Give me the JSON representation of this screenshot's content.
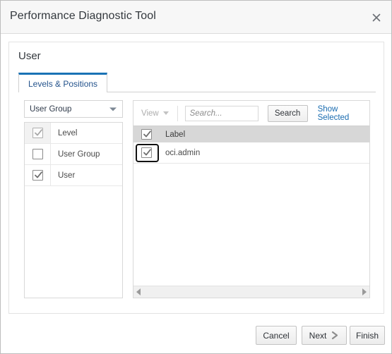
{
  "window": {
    "title": "Performance Diagnostic Tool",
    "close_icon": "close-icon"
  },
  "page": {
    "title": "User"
  },
  "tabs": [
    {
      "label": "Levels & Positions",
      "active": true
    }
  ],
  "left_panel": {
    "dropdown": {
      "selected": "User Group",
      "arrow_icon": "chevron-down-icon"
    },
    "rows": [
      {
        "label": "Level",
        "checked": true,
        "disabled": true
      },
      {
        "label": "User Group",
        "checked": false,
        "disabled": false
      },
      {
        "label": "User",
        "checked": true,
        "disabled": false
      }
    ]
  },
  "right_panel": {
    "toolbar": {
      "view_label": "View",
      "view_arrow_icon": "chevron-down-icon",
      "search_placeholder": "Search...",
      "search_value": "",
      "search_button": "Search",
      "show_selected_link": "Show Selected"
    },
    "grid": {
      "header": {
        "column_label": "Label",
        "select_all_checked": true
      },
      "rows": [
        {
          "label": "oci.admin",
          "checked": true,
          "focused": true
        }
      ]
    },
    "scrollbar": {
      "left_arrow_icon": "arrow-left-icon",
      "right_arrow_icon": "arrow-right-icon"
    }
  },
  "footer": {
    "cancel": "Cancel",
    "next": "Next",
    "next_icon": "chevron-right-icon",
    "finish": "Finish"
  },
  "colors": {
    "accent_blue": "#1a73b5",
    "link_blue": "#1a6cb0",
    "tab_text": "#24538c",
    "header_grey": "#d7d7d7"
  }
}
